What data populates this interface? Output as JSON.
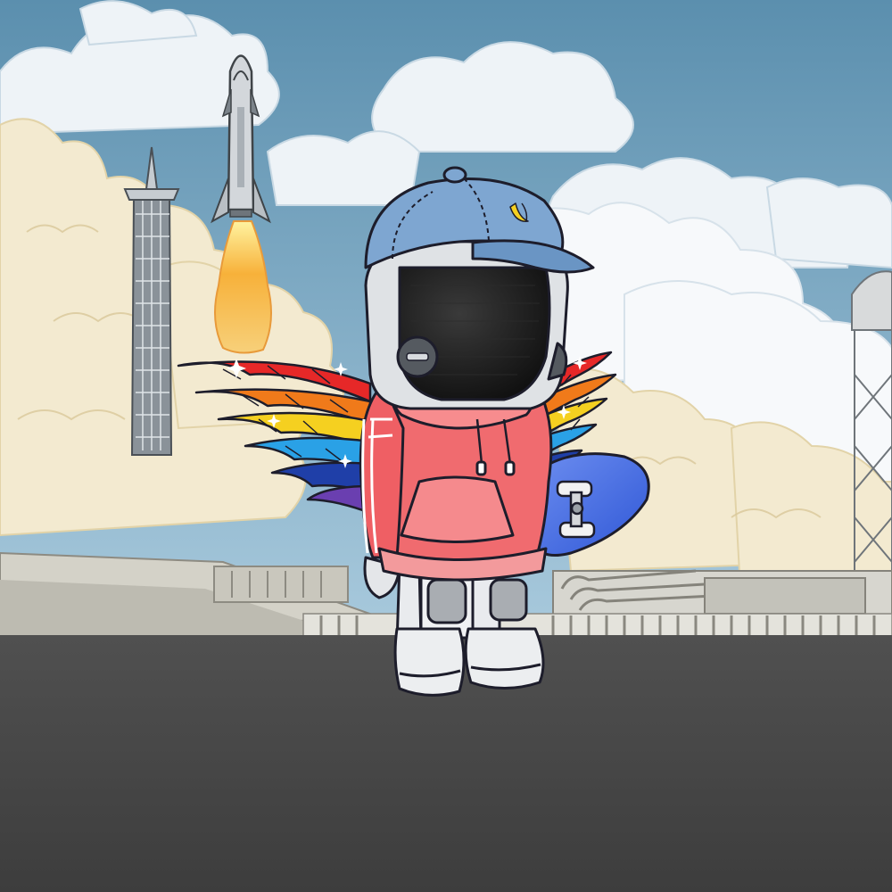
{
  "scene": {
    "elements": [
      "sky",
      "clouds",
      "launch-tower",
      "starship-rocket",
      "rocket-exhaust",
      "smoke-clouds",
      "water-tower",
      "launch-facility",
      "asphalt-ground",
      "astronaut-character",
      "baseball-cap",
      "rainbow-wings",
      "hoodie",
      "skateboard"
    ]
  },
  "cap_badge": "banana-icon",
  "colors": {
    "sky_top": "#5e92b1",
    "sky_bottom": "#a7c9dc",
    "cloud": "#f4f6f8",
    "smoke": "#f1e8c9",
    "ground": "#474747",
    "cap": "#7ea6d1",
    "hoodie": "#f06b6f",
    "skateboard": "#4a72e8",
    "flame": "#f5a23a",
    "wing_colors": [
      "#e62828",
      "#f07a1a",
      "#f5d020",
      "#2aa1e6",
      "#1f3fa8",
      "#6a3fb0"
    ]
  }
}
